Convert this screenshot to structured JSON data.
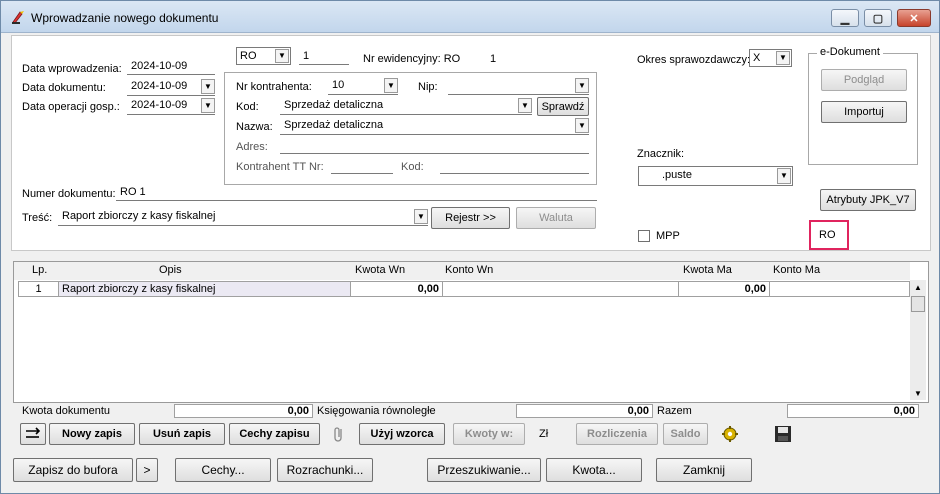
{
  "window": {
    "title": "Wprowadzanie nowego dokumentu",
    "minimize_glyph": "▁",
    "maximize_glyph": "▢",
    "close_glyph": "✕"
  },
  "header": {
    "date_entry_label": "Data wprowadzenia:",
    "date_entry_value": "2024-10-09",
    "date_doc_label": "Data dokumentu:",
    "date_doc_value": "2024-10-09",
    "date_op_label": "Data operacji gosp.:",
    "date_op_value": "2024-10-09",
    "doc_type_value": "RO",
    "doc_number_seq": "1",
    "nr_ewidencyjny_label": "Nr ewidencyjny: RO",
    "nr_ewidencyjny_value": "1",
    "numer_dokumentu_label": "Numer dokumentu:",
    "numer_dokumentu_value": "RO 1",
    "tresc_label": "Treść:",
    "tresc_value": "Raport zbiorczy z kasy fiskalnej",
    "rejestr_button": "Rejestr >>",
    "waluta_button": "Waluta"
  },
  "contractor": {
    "nr_label": "Nr kontrahenta:",
    "nr_value": "10",
    "nip_label": "Nip:",
    "nip_value": "",
    "kod_label": "Kod:",
    "kod_value": "Sprzedaż detaliczna",
    "sprawdz_button": "Sprawdź",
    "nazwa_label": "Nazwa:",
    "nazwa_value": "Sprzedaż detaliczna",
    "adres_label": "Adres:",
    "tt_label": "Kontrahent TT Nr:",
    "kod2_label": "Kod:"
  },
  "right": {
    "okres_label": "Okres sprawozdawczy:",
    "okres_value": "X",
    "edoc_title": "e-Dokument",
    "podglad_button": "Podgląd",
    "importuj_button": "Importuj",
    "znacznik_label": "Znacznik:",
    "znacznik_value": ".puste",
    "atrybuty_button": "Atrybuty JPK_V7",
    "mpp_label": "MPP",
    "highlight_value": "RO"
  },
  "grid": {
    "columns": [
      "Lp.",
      "Opis",
      "Kwota  Wn",
      "Konto  Wn",
      "Kwota  Ma",
      "Konto  Ma"
    ],
    "rows": [
      {
        "lp": "1",
        "opis": "Raport zbiorczy z kasy fiskalnej",
        "kwota_wn": "0,00",
        "konto_wn": "",
        "kwota_ma": "0,00",
        "konto_ma": ""
      }
    ]
  },
  "summary": {
    "kwota_dok_label": "Kwota dokumentu",
    "kwota_dok_value": "0,00",
    "ksieg_label": "Księgowania równoległe",
    "ksieg_value": "0,00",
    "razem_label": "Razem",
    "razem_value": "0,00"
  },
  "toolbar": {
    "nowy_zapis": "Nowy zapis",
    "usun_zapis": "Usuń zapis",
    "cechy_zapisu": "Cechy zapisu",
    "uzyj_wzorca": "Użyj wzorca",
    "kwoty_w": "Kwoty w:",
    "currency": "Zł",
    "rozliczenia": "Rozliczenia",
    "saldo": "Saldo"
  },
  "footer": {
    "zapisz": "Zapisz do bufora",
    "more": ">",
    "cechy": "Cechy...",
    "rozrachunki": "Rozrachunki...",
    "przeszukiwanie": "Przeszukiwanie...",
    "kwota": "Kwota...",
    "zamknij": "Zamknij"
  }
}
